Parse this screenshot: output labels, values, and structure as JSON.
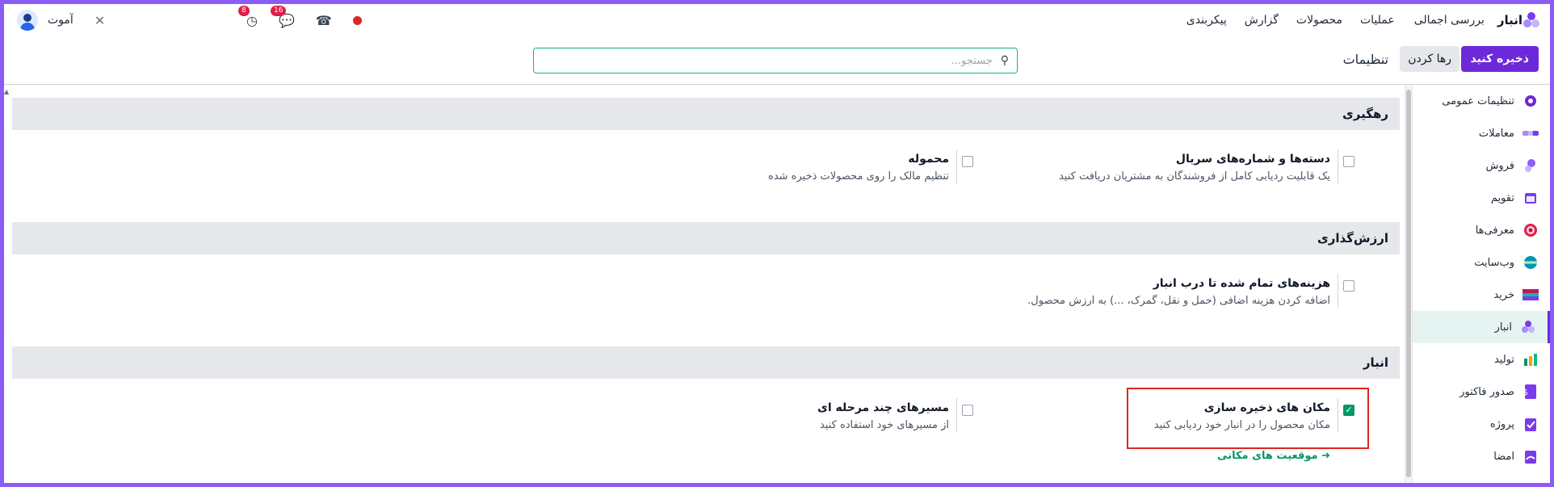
{
  "nav": {
    "app_name": "انبار",
    "menu": [
      "بررسی اجمالی",
      "عملیات",
      "محصولات",
      "گزارش",
      "پیکربندی"
    ],
    "user_name": "آموت",
    "badges": {
      "activity": "8",
      "messages": "16"
    }
  },
  "control": {
    "save_label": "ذخیره کنید",
    "discard_label": "رها کردن",
    "title": "تنظیمات",
    "search_placeholder": "جستجو..."
  },
  "sidebar": {
    "items": [
      {
        "label": "تنظیمات عمومی",
        "icon": "gear-icon",
        "color": "#6d28d9"
      },
      {
        "label": "معاملات",
        "icon": "handshake-icon",
        "color": "#7c3aed"
      },
      {
        "label": "فروش",
        "icon": "sales-icon",
        "color": "#8b5cf6"
      },
      {
        "label": "تقویم",
        "icon": "calendar-icon",
        "color": "#7c3aed"
      },
      {
        "label": "معرفی‌ها",
        "icon": "referral-icon",
        "color": "#e11d48"
      },
      {
        "label": "وب‌سایت",
        "icon": "website-icon",
        "color": "#0891b2"
      },
      {
        "label": "خرید",
        "icon": "purchase-icon",
        "color": "#be185d"
      },
      {
        "label": "انبار",
        "icon": "inventory-icon",
        "color": "#7c3aed",
        "active": true
      },
      {
        "label": "تولید",
        "icon": "manufacturing-icon",
        "color": "#059669"
      },
      {
        "label": "صدور فاکتور",
        "icon": "invoice-icon",
        "color": "#7c3aed"
      },
      {
        "label": "پروژه",
        "icon": "project-icon",
        "color": "#7c3aed"
      },
      {
        "label": "امضا",
        "icon": "sign-icon",
        "color": "#7c3aed"
      }
    ]
  },
  "sections": {
    "tracking": {
      "title": "رهگیری",
      "s1_title": "دسته‌ها و شماره‌های سریال",
      "s1_desc": "یک قابلیت ردیابی کامل از فروشندگان به مشتریان دریافت کنید",
      "s2_title": "محموله",
      "s2_desc": "تنظیم مالک را روی محصولات ذخیره شده"
    },
    "valuation": {
      "title": "ارزش‌گذاری",
      "s1_title": "هزینه‌های تمام شده تا درب انبار",
      "s1_desc": "اضافه کردن هزینه اضافی (حمل و نقل، گمرک، ...) به ارزش محصول."
    },
    "warehouse": {
      "title": "انبار",
      "s1_title": "مکان های ذخیره سازی",
      "s1_desc": "مکان محصول را در انبار خود ردیابی کنید",
      "s1_link": "موقعیت های مکانی",
      "s2_title": "مسیرهای چند مرحله ای",
      "s2_desc": "از مسیرهای خود استفاده کنید"
    }
  }
}
